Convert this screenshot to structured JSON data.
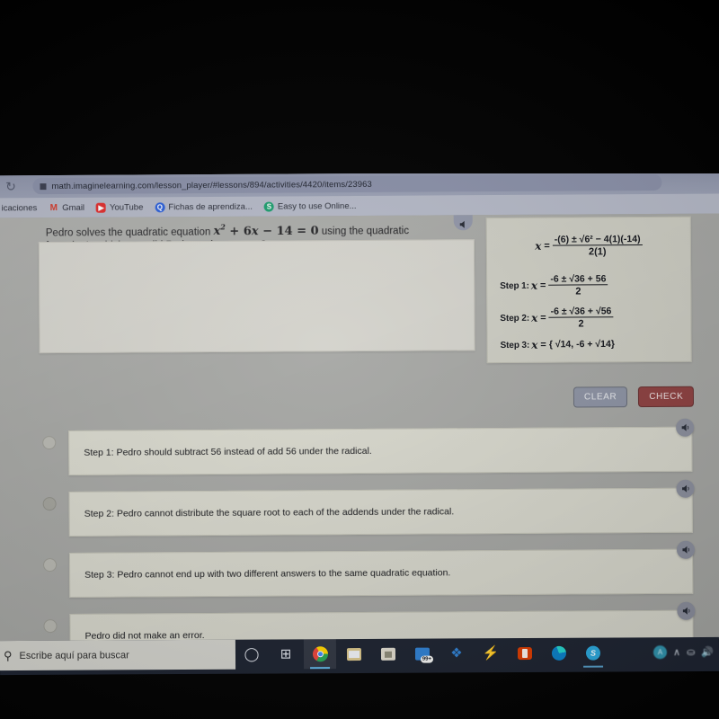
{
  "browser": {
    "nav": {
      "forward_icon": "arrow-forward-icon",
      "reload_icon": "reload-icon",
      "lock_icon": "site-info-icon"
    },
    "url": "math.imaginelearning.com/lesson_player/#lessons/894/activities/4420/items/23963",
    "bookmarks": [
      {
        "label": "icaciones",
        "icon": "bookmark-icon"
      },
      {
        "label": "Gmail",
        "icon": "gmail-icon"
      },
      {
        "label": "YouTube",
        "icon": "youtube-icon"
      },
      {
        "label": "Fichas de aprendiza...",
        "icon": "quizlet-icon"
      },
      {
        "label": "Easy to use Online...",
        "icon": "smallpdf-icon"
      }
    ]
  },
  "lesson": {
    "prompt": {
      "line1_a": "Pedro solves the quadratic equation ",
      "equation": "x² + 6x − 14 = 0",
      "line1_b": " using the quadratic",
      "line2": "formula. In which step did Pedro make an error?"
    },
    "work": {
      "formula": {
        "lhs": "x",
        "eq": "=",
        "numerator": "-(6) ± √6² − 4(1)(-14)",
        "denominator": "2(1)"
      },
      "steps": [
        {
          "label": "Step 1:",
          "lhs": "x",
          "eq": "=",
          "numerator": "-6 ± √36 + 56",
          "denominator": "2"
        },
        {
          "label": "Step 2:",
          "lhs": "x",
          "eq": "=",
          "numerator": "-6 ± √36 + √56",
          "denominator": "2"
        },
        {
          "label": "Step 3:",
          "lhs": "x",
          "eq": "=",
          "value": "{ √14, -6 + √14}"
        }
      ]
    },
    "buttons": {
      "clear": "CLEAR",
      "check": "CHECK"
    },
    "options": [
      {
        "label": "Step 1: Pedro should subtract 56 instead of add 56 under the radical.",
        "selected": false,
        "speaker_icon": "speaker-icon"
      },
      {
        "label": "Step 2: Pedro cannot distribute the square root to each of the addends under the radical.",
        "selected": false,
        "speaker_icon": "speaker-icon"
      },
      {
        "label": "Step 3: Pedro cannot end up with two different answers to the same quadratic equation.",
        "selected": false,
        "speaker_icon": "speaker-icon"
      },
      {
        "label": "Pedro did not make an error.",
        "selected": false,
        "speaker_icon": "speaker-icon"
      }
    ]
  },
  "taskbar": {
    "search_placeholder": "Escribe aquí para buscar",
    "search_icon": "search-icon",
    "items": [
      {
        "name": "cortana-icon",
        "label": ""
      },
      {
        "name": "task-view-icon",
        "label": ""
      },
      {
        "name": "chrome-icon",
        "label": ""
      },
      {
        "name": "file-explorer-icon",
        "label": ""
      },
      {
        "name": "microsoft-store-icon",
        "label": ""
      },
      {
        "name": "messages-icon",
        "badge": "99+"
      },
      {
        "name": "dropbox-icon",
        "label": ""
      },
      {
        "name": "lightning-icon",
        "label": ""
      },
      {
        "name": "office-icon",
        "label": ""
      },
      {
        "name": "edge-icon",
        "label": ""
      },
      {
        "name": "skype-icon",
        "label": "S"
      }
    ],
    "tray": {
      "avatar": "A",
      "chevron": "∧",
      "network_icon": "network-icon",
      "volume_icon": "volume-icon"
    }
  },
  "colors": {
    "check_button": "#8e4040",
    "clear_button": "#8d93a4",
    "page_background": "#a6a7a4",
    "card_background": "#d8d8cd",
    "taskbar": "#1d2330"
  }
}
